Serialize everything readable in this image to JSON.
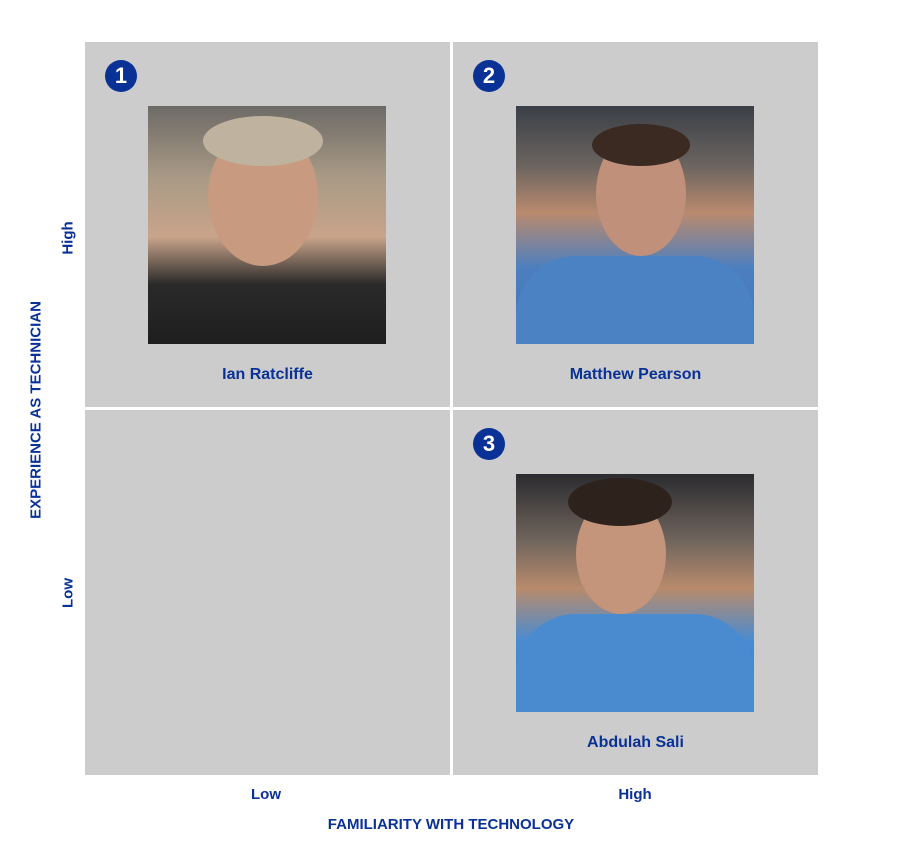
{
  "axes": {
    "y_title": "EXPERIENCE AS TECHNICIAN",
    "y_high": "High",
    "y_low": "Low",
    "x_title": "FAMILIARITY WITH TECHNOLOGY",
    "x_low": "Low",
    "x_high": "High"
  },
  "quadrants": [
    {
      "position": "high-experience-low-tech",
      "badge": "1",
      "name": "Ian Ratcliffe"
    },
    {
      "position": "high-experience-high-tech",
      "badge": "2",
      "name": "Matthew Pearson"
    },
    {
      "position": "low-experience-low-tech"
    },
    {
      "position": "low-experience-high-tech",
      "badge": "3",
      "name": "Abdulah Sali"
    }
  ],
  "colors": {
    "accent": "#0a3296",
    "quadrant_bg": "#cccccc"
  }
}
